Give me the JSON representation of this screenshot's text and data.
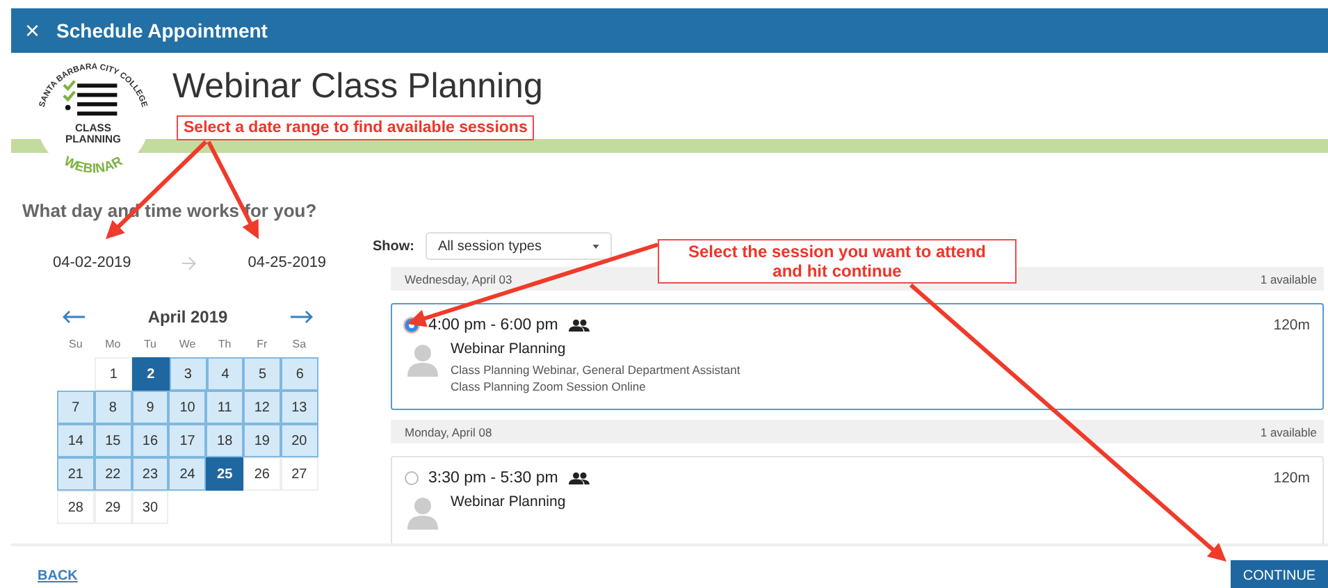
{
  "dialog": {
    "close": "×",
    "title": "Schedule Appointment"
  },
  "logo": {
    "arc_text": "SANTA BARBARA CITY COLLEGE",
    "lines": [
      "CLASS",
      "PLANNING"
    ],
    "bottom_text": "WEBINAR"
  },
  "page_title": "Webinar Class Planning",
  "question": "What day and time works for you?",
  "range": {
    "start": "04-02-2019",
    "end": "04-25-2019"
  },
  "calendar": {
    "month": "April 2019",
    "weekdays": [
      "Su",
      "Mo",
      "Tu",
      "We",
      "Th",
      "Fr",
      "Sa"
    ],
    "weeks": [
      [
        {
          "day": "1",
          "in_range": false,
          "selected": false
        },
        {
          "day": "2",
          "in_range": true,
          "selected": true
        },
        {
          "day": "3",
          "in_range": true,
          "selected": false
        },
        {
          "day": "4",
          "in_range": true,
          "selected": false
        },
        {
          "day": "5",
          "in_range": true,
          "selected": false
        },
        {
          "day": "6",
          "in_range": true,
          "selected": false
        }
      ],
      [
        {
          "day": "7",
          "in_range": true,
          "selected": false
        },
        {
          "day": "8",
          "in_range": true,
          "selected": false
        },
        {
          "day": "9",
          "in_range": true,
          "selected": false
        },
        {
          "day": "10",
          "in_range": true,
          "selected": false
        },
        {
          "day": "11",
          "in_range": true,
          "selected": false
        },
        {
          "day": "12",
          "in_range": true,
          "selected": false
        },
        {
          "day": "13",
          "in_range": true,
          "selected": false
        }
      ],
      [
        {
          "day": "14",
          "in_range": true,
          "selected": false
        },
        {
          "day": "15",
          "in_range": true,
          "selected": false
        },
        {
          "day": "16",
          "in_range": true,
          "selected": false
        },
        {
          "day": "17",
          "in_range": true,
          "selected": false
        },
        {
          "day": "18",
          "in_range": true,
          "selected": false
        },
        {
          "day": "19",
          "in_range": true,
          "selected": false
        },
        {
          "day": "20",
          "in_range": true,
          "selected": false
        }
      ],
      [
        {
          "day": "21",
          "in_range": true,
          "selected": false
        },
        {
          "day": "22",
          "in_range": true,
          "selected": false
        },
        {
          "day": "23",
          "in_range": true,
          "selected": false
        },
        {
          "day": "24",
          "in_range": true,
          "selected": false
        },
        {
          "day": "25",
          "in_range": true,
          "selected": true
        },
        {
          "day": "26",
          "in_range": false,
          "selected": false
        },
        {
          "day": "27",
          "in_range": false,
          "selected": false
        }
      ],
      [
        {
          "day": "28",
          "in_range": false,
          "selected": false
        },
        {
          "day": "29",
          "in_range": false,
          "selected": false
        },
        {
          "day": "30",
          "in_range": false,
          "selected": false
        }
      ]
    ]
  },
  "filter": {
    "label": "Show:",
    "value": "All session types"
  },
  "session_groups": [
    {
      "date": "Wednesday, April 03",
      "availability": "1 available",
      "sessions": [
        {
          "time": "4:00 pm - 6:00 pm",
          "selected": true,
          "duration": "120m",
          "title": "Webinar Planning",
          "details": [
            "Class Planning Webinar, General Department Assistant",
            "Class Planning Zoom Session Online"
          ]
        }
      ]
    },
    {
      "date": "Monday, April 08",
      "availability": "1 available",
      "sessions": [
        {
          "time": "3:30 pm - 5:30 pm",
          "selected": false,
          "duration": "120m",
          "title": "Webinar Planning"
        }
      ]
    }
  ],
  "footer": {
    "back": "BACK",
    "continue": "CONTINUE"
  },
  "annotations": [
    {
      "lines": [
        "Select a date range to find available sessions"
      ]
    },
    {
      "lines": [
        "Select the session you want to attend",
        "and hit continue"
      ]
    }
  ]
}
